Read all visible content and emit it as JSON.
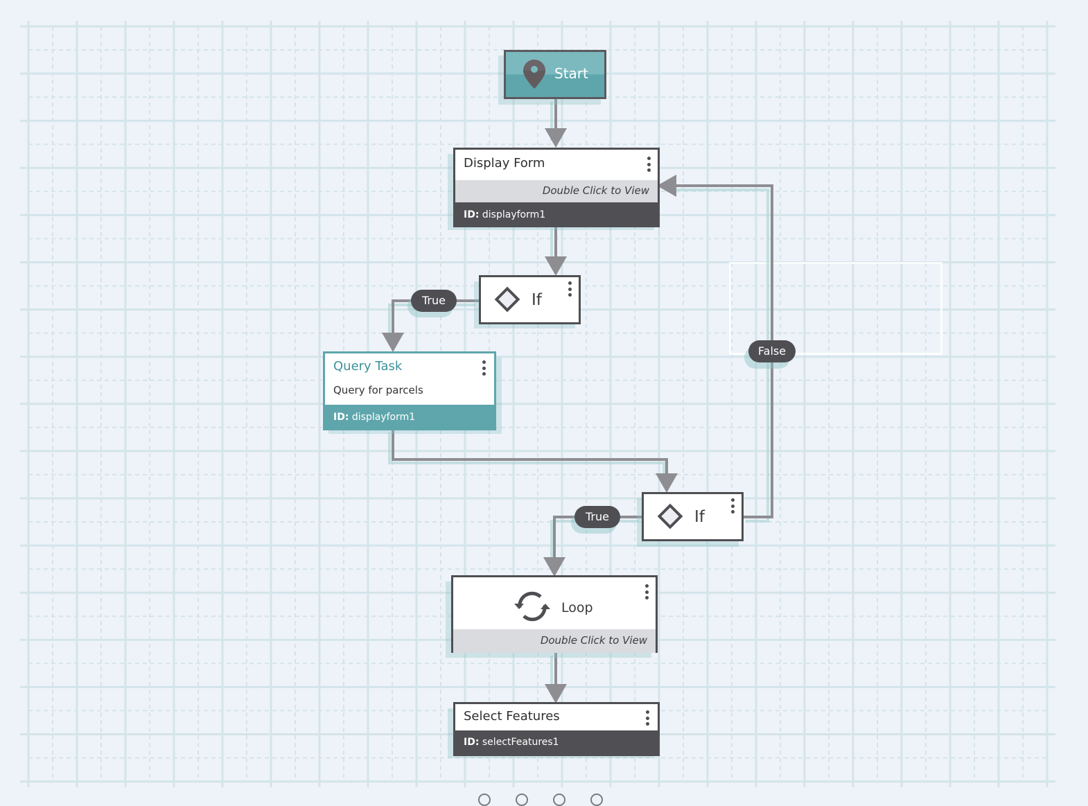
{
  "canvas": {
    "background": "#eef3f9",
    "grid_color": "#d3e4ea",
    "connector_color": "#8d8d92",
    "accent_teal": "#5ea6ac",
    "dark_footer": "#505054"
  },
  "nodes": {
    "start": {
      "label": "Start",
      "icon": "map-pin-icon"
    },
    "display_form": {
      "title": "Display Form",
      "subtitle": "Double Click to View",
      "id_label": "ID:",
      "id_value": "displayform1",
      "menu_icon": "kebab-menu-icon"
    },
    "if1": {
      "label": "If",
      "icon": "diamond-icon",
      "menu_icon": "kebab-menu-icon"
    },
    "query_task": {
      "title": "Query Task",
      "description": "Query for parcels",
      "id_label": "ID:",
      "id_value": "displayform1",
      "menu_icon": "kebab-menu-icon"
    },
    "if2": {
      "label": "If",
      "icon": "diamond-icon",
      "menu_icon": "kebab-menu-icon"
    },
    "loop": {
      "label": "Loop",
      "icon": "loop-arrows-icon",
      "subtitle": "Double Click to View",
      "menu_icon": "kebab-menu-icon"
    },
    "select_features": {
      "title": "Select Features",
      "id_label": "ID:",
      "id_value": "selectFeatures1",
      "menu_icon": "kebab-menu-icon"
    }
  },
  "edges": [
    {
      "from": "start",
      "to": "display_form",
      "label": ""
    },
    {
      "from": "display_form",
      "to": "if1",
      "label": ""
    },
    {
      "from": "if1",
      "to": "query_task",
      "label": "True"
    },
    {
      "from": "query_task",
      "to": "if2",
      "label": ""
    },
    {
      "from": "if2",
      "to": "loop",
      "label": "True"
    },
    {
      "from": "if2",
      "to": "display_form",
      "label": "False"
    },
    {
      "from": "loop",
      "to": "select_features",
      "label": ""
    }
  ],
  "edge_labels": {
    "if1_true": "True",
    "if2_true": "True",
    "if2_false": "False"
  }
}
